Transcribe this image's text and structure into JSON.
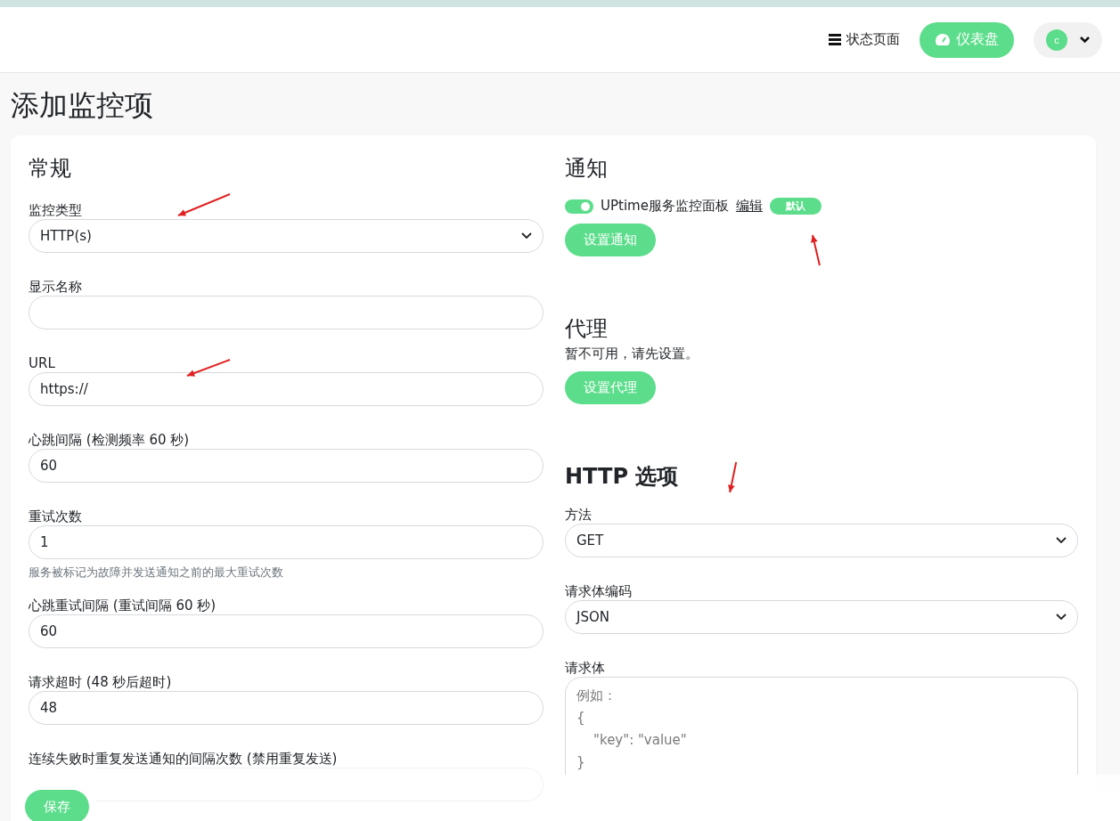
{
  "header": {
    "status_link": "状态页面",
    "dashboard_button": "仪表盘",
    "avatar_letter": "c"
  },
  "title": "添加监控项",
  "general": {
    "heading": "常规",
    "fields": [
      {
        "kind": "select",
        "label": "监控类型",
        "value": "HTTP(s)"
      },
      {
        "kind": "input",
        "label": "显示名称"
      },
      {
        "kind": "input",
        "label": "URL",
        "value": "https://"
      },
      {
        "kind": "input",
        "label": "心跳间隔 (检测频率 60 秒)",
        "value": "60"
      },
      {
        "kind": "input",
        "label": "重试次数",
        "value": "1",
        "hint": "服务被标记为故障并发送通知之前的最大重试次数"
      },
      {
        "kind": "input",
        "label": "心跳重试间隔 (重试间隔 60 秒)",
        "value": "60"
      },
      {
        "kind": "input",
        "label": "请求超时 (48 秒后超时)",
        "value": "48"
      },
      {
        "kind": "input",
        "label": "连续失败时重复发送通知的间隔次数 (禁用重复发送)"
      }
    ]
  },
  "notifications": {
    "heading": "通知",
    "items": [
      {
        "name": "UPtime服务监控面板",
        "on": true,
        "edit": "编辑",
        "badge": "默认"
      }
    ],
    "button": "设置通知"
  },
  "proxy": {
    "heading": "代理",
    "message": "暂不可用，请先设置。",
    "button": "设置代理"
  },
  "http": {
    "heading": "HTTP 选项",
    "fields": [
      {
        "kind": "select",
        "label": "方法",
        "value": "GET"
      },
      {
        "kind": "select",
        "label": "请求体编码",
        "value": "JSON"
      },
      {
        "kind": "textarea",
        "label": "请求体",
        "placeholder": "例如：\n{\n    \"key\": \"value\"\n}"
      }
    ]
  },
  "save_button": "保存"
}
